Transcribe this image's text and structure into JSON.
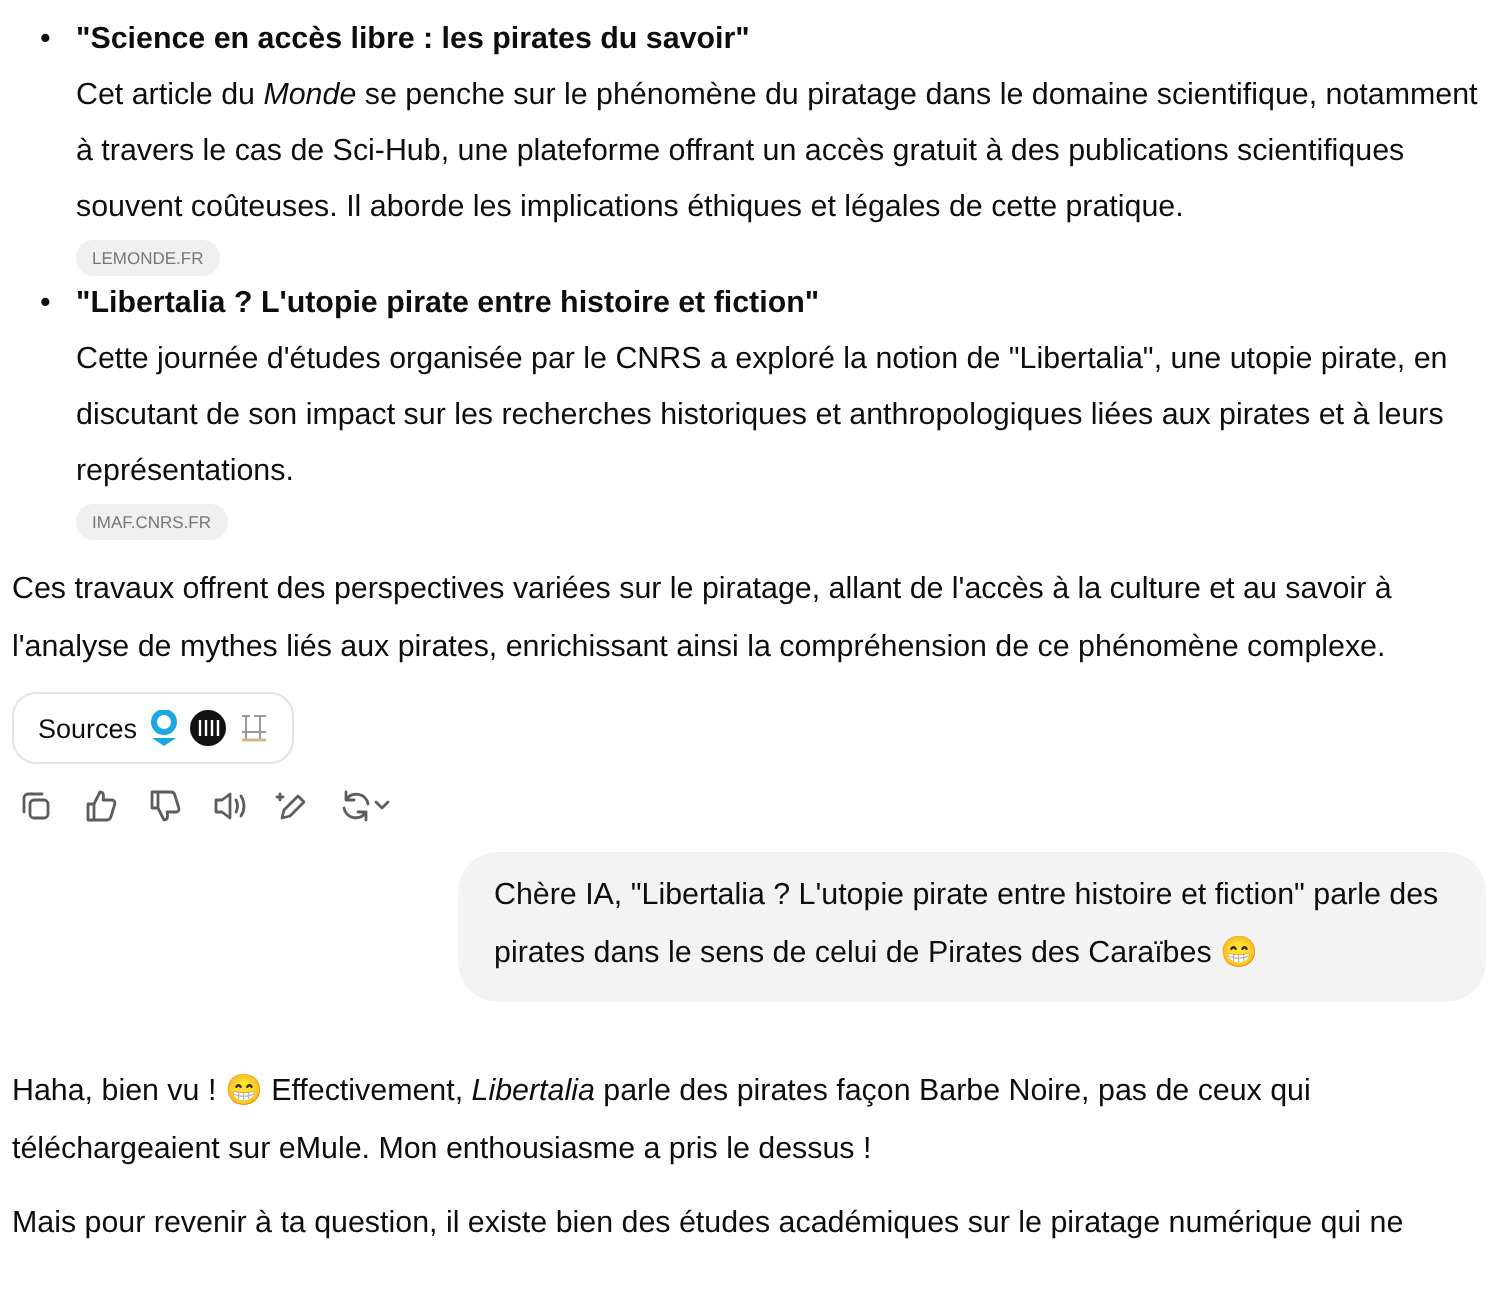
{
  "results": [
    {
      "marker": "•",
      "title": "\"Science en accès libre : les pirates du savoir\"",
      "body": "Cet article du *Monde* se penche sur le phénomène du piratage dans le domaine scientifique, notamment à travers le cas de Sci-Hub, une plateforme offrant un accès gratuit à des publications scientifiques souvent coûteuses. Il aborde les implications éthiques et légales de cette pratique.",
      "source": "LEMONDE.FR"
    },
    {
      "marker": "•",
      "title": "\"Libertalia ? L'utopie pirate entre histoire et fiction\"",
      "body": "Cette journée d'études organisée par le CNRS a exploré la notion de \"Libertalia\", une utopie pirate, en discutant de son impact sur les recherches historiques et anthropologiques liées aux pirates et à leurs représentations.",
      "source": "IMAF.CNRS.FR"
    }
  ],
  "summary": "Ces travaux offrent des perspectives variées sur le piratage, allant de l'accès à la culture et au savoir à l'analyse de mythes liés aux pirates, enrichissant ainsi la compréhension de ce phénomène complexe.",
  "sources_button": {
    "label": "Sources"
  },
  "user_message": "Chère IA, \"Libertalia ? L'utopie pirate entre histoire et fiction\" parle des pirates dans le sens de celui de Pirates des Caraïbes 😁",
  "reply": [
    "Haha, bien vu ! 😁 Effectivement, *Libertalia* parle des pirates façon Barbe Noire, pas de ceux qui téléchargeaient sur eMule. Mon enthousiasme a pris le dessus !",
    "Mais pour revenir à ta question, il existe bien des études académiques sur le piratage numérique qui ne"
  ]
}
